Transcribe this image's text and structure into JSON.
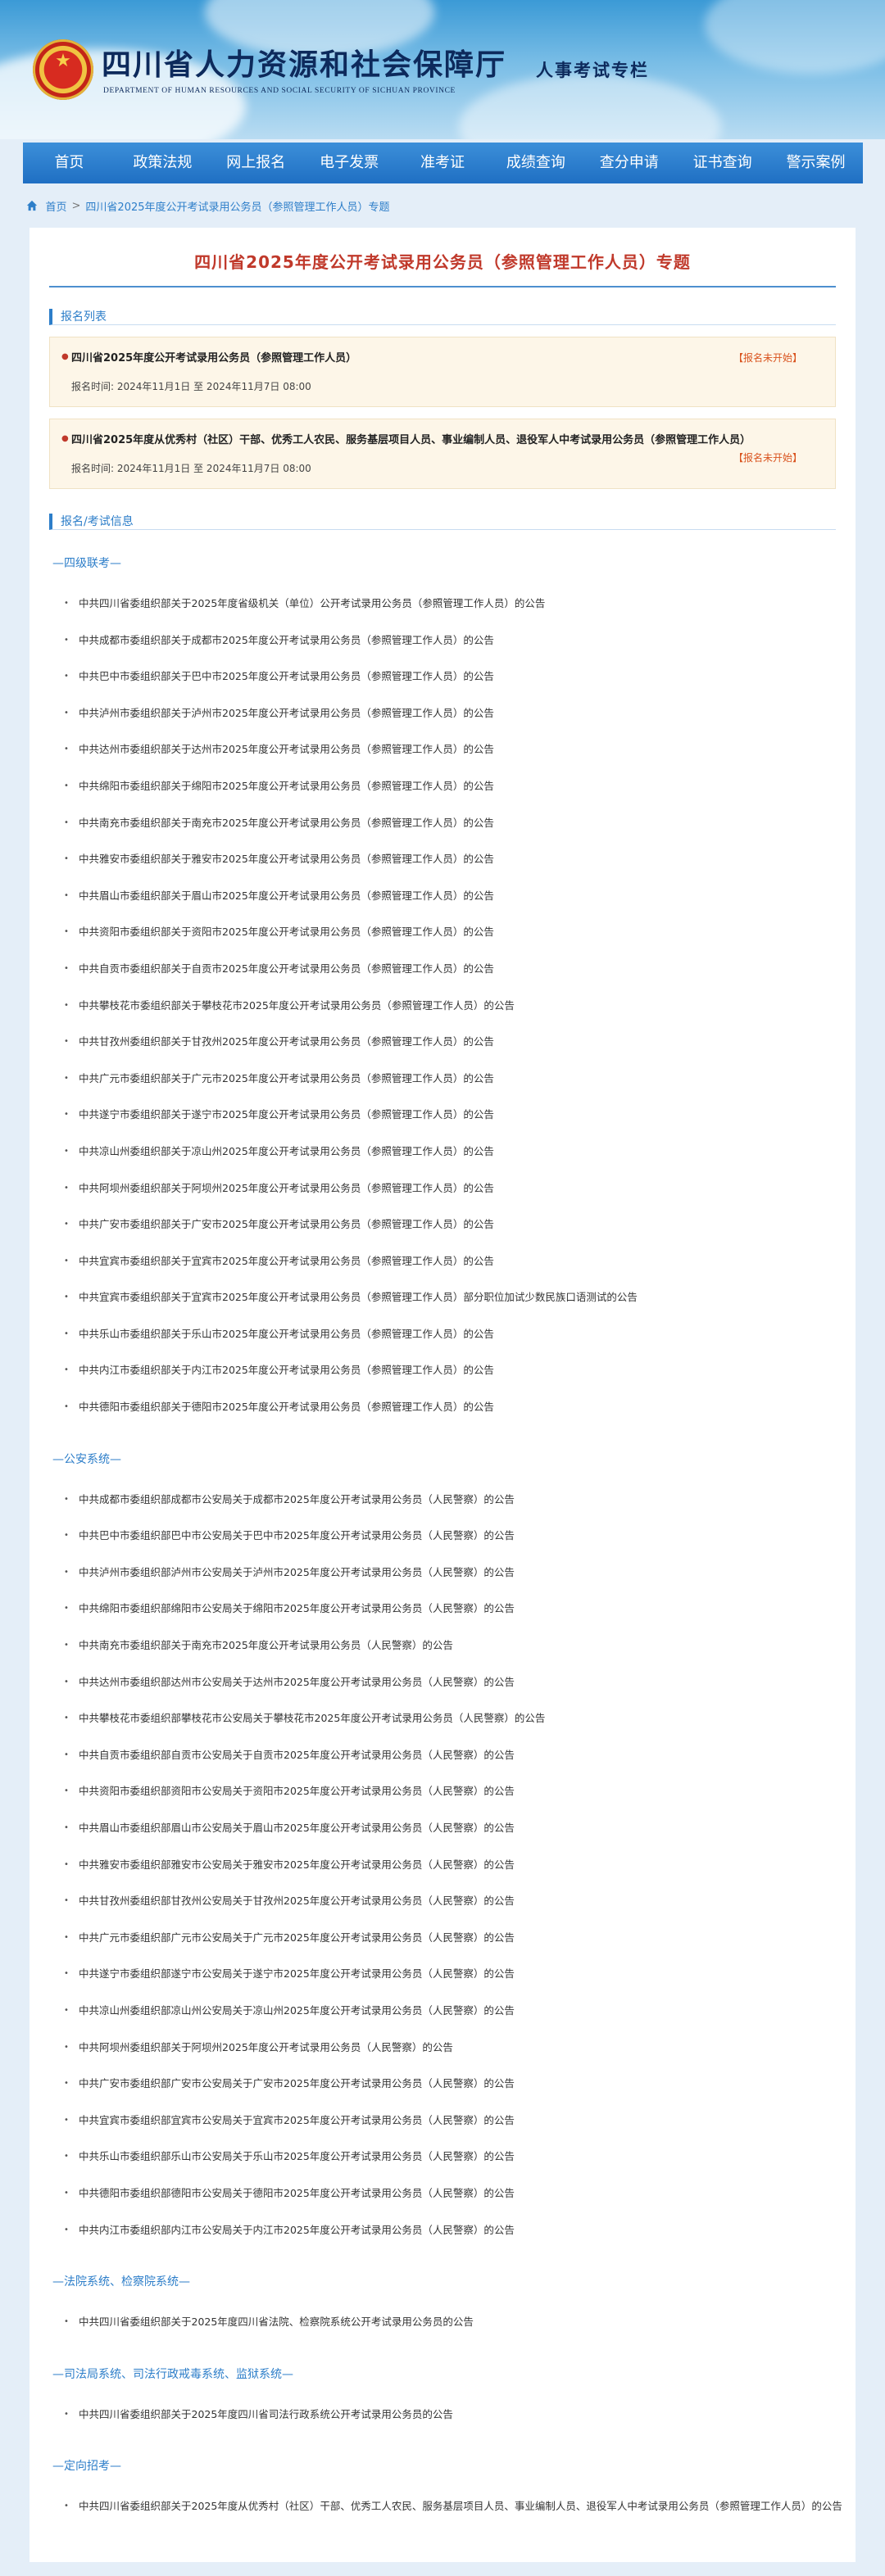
{
  "header": {
    "site_title": "四川省人力资源和社会保障厅",
    "site_subtitle": "DEPARTMENT OF HUMAN RESOURCES AND SOCIAL SECURITY OF SICHUAN PROVINCE",
    "column_title": "人事考试专栏"
  },
  "nav": [
    "首页",
    "政策法规",
    "网上报名",
    "电子发票",
    "准考证",
    "成绩查询",
    "查分申请",
    "证书查询",
    "警示案例"
  ],
  "breadcrumb": {
    "home": "首页",
    "sep": ">",
    "current": "四川省2025年度公开考试录用公务员（参照管理工作人员）专题"
  },
  "page_title": "四川省2025年度公开考试录用公务员（参照管理工作人员）专题",
  "registration": {
    "heading": "报名列表",
    "items": [
      {
        "title": "四川省2025年度公开考试录用公务员（参照管理工作人员）",
        "status": "【报名未开始】",
        "time": "报名时间:  2024年11月1日 至 2024年11月7日 08:00"
      },
      {
        "title": "四川省2025年度从优秀村（社区）干部、优秀工人农民、服务基层项目人员、事业编制人员、退役军人中考试录用公务员（参照管理工作人员）",
        "status": "【报名未开始】",
        "time": "报名时间:  2024年11月1日 至 2024年11月7日 08:00"
      }
    ]
  },
  "info": {
    "heading": "报名/考试信息",
    "categories": [
      {
        "name": "—四级联考—",
        "items": [
          "中共四川省委组织部关于2025年度省级机关（单位）公开考试录用公务员（参照管理工作人员）的公告",
          "中共成都市委组织部关于成都市2025年度公开考试录用公务员（参照管理工作人员）的公告",
          "中共巴中市委组织部关于巴中市2025年度公开考试录用公务员（参照管理工作人员）的公告",
          "中共泸州市委组织部关于泸州市2025年度公开考试录用公务员（参照管理工作人员）的公告",
          "中共达州市委组织部关于达州市2025年度公开考试录用公务员（参照管理工作人员）的公告",
          "中共绵阳市委组织部关于绵阳市2025年度公开考试录用公务员（参照管理工作人员）的公告",
          "中共南充市委组织部关于南充市2025年度公开考试录用公务员（参照管理工作人员）的公告",
          "中共雅安市委组织部关于雅安市2025年度公开考试录用公务员（参照管理工作人员）的公告",
          "中共眉山市委组织部关于眉山市2025年度公开考试录用公务员（参照管理工作人员）的公告",
          "中共资阳市委组织部关于资阳市2025年度公开考试录用公务员（参照管理工作人员）的公告",
          "中共自贡市委组织部关于自贡市2025年度公开考试录用公务员（参照管理工作人员）的公告",
          "中共攀枝花市委组织部关于攀枝花市2025年度公开考试录用公务员（参照管理工作人员）的公告",
          "中共甘孜州委组织部关于甘孜州2025年度公开考试录用公务员（参照管理工作人员）的公告",
          "中共广元市委组织部关于广元市2025年度公开考试录用公务员（参照管理工作人员）的公告",
          "中共遂宁市委组织部关于遂宁市2025年度公开考试录用公务员（参照管理工作人员）的公告",
          "中共凉山州委组织部关于凉山州2025年度公开考试录用公务员（参照管理工作人员）的公告",
          "中共阿坝州委组织部关于阿坝州2025年度公开考试录用公务员（参照管理工作人员）的公告",
          "中共广安市委组织部关于广安市2025年度公开考试录用公务员（参照管理工作人员）的公告",
          "中共宜宾市委组织部关于宜宾市2025年度公开考试录用公务员（参照管理工作人员）的公告",
          "中共宜宾市委组织部关于宜宾市2025年度公开考试录用公务员（参照管理工作人员）部分职位加试少数民族口语测试的公告",
          "中共乐山市委组织部关于乐山市2025年度公开考试录用公务员（参照管理工作人员）的公告",
          "中共内江市委组织部关于内江市2025年度公开考试录用公务员（参照管理工作人员）的公告",
          "中共德阳市委组织部关于德阳市2025年度公开考试录用公务员（参照管理工作人员）的公告"
        ]
      },
      {
        "name": "—公安系统—",
        "items": [
          "中共成都市委组织部成都市公安局关于成都市2025年度公开考试录用公务员（人民警察）的公告",
          "中共巴中市委组织部巴中市公安局关于巴中市2025年度公开考试录用公务员（人民警察）的公告",
          "中共泸州市委组织部泸州市公安局关于泸州市2025年度公开考试录用公务员（人民警察）的公告",
          "中共绵阳市委组织部绵阳市公安局关于绵阳市2025年度公开考试录用公务员（人民警察）的公告",
          "中共南充市委组织部关于南充市2025年度公开考试录用公务员（人民警察）的公告",
          "中共达州市委组织部达州市公安局关于达州市2025年度公开考试录用公务员（人民警察）的公告",
          "中共攀枝花市委组织部攀枝花市公安局关于攀枝花市2025年度公开考试录用公务员（人民警察）的公告",
          "中共自贡市委组织部自贡市公安局关于自贡市2025年度公开考试录用公务员（人民警察）的公告",
          "中共资阳市委组织部资阳市公安局关于资阳市2025年度公开考试录用公务员（人民警察）的公告",
          "中共眉山市委组织部眉山市公安局关于眉山市2025年度公开考试录用公务员（人民警察）的公告",
          "中共雅安市委组织部雅安市公安局关于雅安市2025年度公开考试录用公务员（人民警察）的公告",
          "中共甘孜州委组织部甘孜州公安局关于甘孜州2025年度公开考试录用公务员（人民警察）的公告",
          "中共广元市委组织部广元市公安局关于广元市2025年度公开考试录用公务员（人民警察）的公告",
          "中共遂宁市委组织部遂宁市公安局关于遂宁市2025年度公开考试录用公务员（人民警察）的公告",
          "中共凉山州委组织部凉山州公安局关于凉山州2025年度公开考试录用公务员（人民警察）的公告",
          "中共阿坝州委组织部关于阿坝州2025年度公开考试录用公务员（人民警察）的公告",
          "中共广安市委组织部广安市公安局关于广安市2025年度公开考试录用公务员（人民警察）的公告",
          "中共宜宾市委组织部宜宾市公安局关于宜宾市2025年度公开考试录用公务员（人民警察）的公告",
          "中共乐山市委组织部乐山市公安局关于乐山市2025年度公开考试录用公务员（人民警察）的公告",
          "中共德阳市委组织部德阳市公安局关于德阳市2025年度公开考试录用公务员（人民警察）的公告",
          "中共内江市委组织部内江市公安局关于内江市2025年度公开考试录用公务员（人民警察）的公告"
        ]
      },
      {
        "name": "—法院系统、检察院系统—",
        "items": [
          "中共四川省委组织部关于2025年度四川省法院、检察院系统公开考试录用公务员的公告"
        ]
      },
      {
        "name": "—司法局系统、司法行政戒毒系统、监狱系统—",
        "items": [
          "中共四川省委组织部关于2025年度四川省司法行政系统公开考试录用公务员的公告"
        ]
      },
      {
        "name": "—定向招考—",
        "items": [
          "中共四川省委组织部关于2025年度从优秀村（社区）干部、优秀工人农民、服务基层项目人员、事业编制人员、退役军人中考试录用公务员（参照管理工作人员）的公告"
        ]
      }
    ]
  }
}
